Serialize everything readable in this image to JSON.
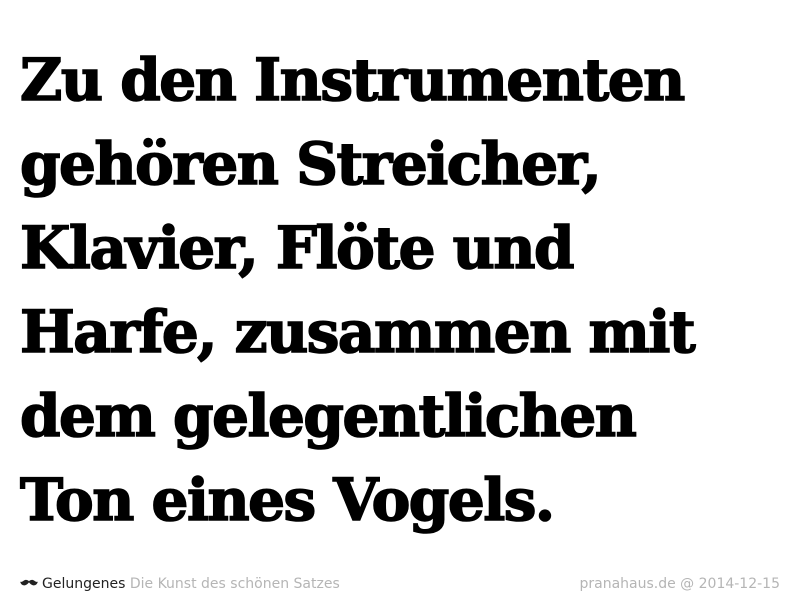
{
  "quote": {
    "lines": [
      "Zu den Instrumenten",
      "gehören Streicher,",
      "Klavier, Flöte und",
      "Harfe, zusammen mit",
      "dem gelegentlichen",
      "Ton eines Vogels."
    ]
  },
  "footer": {
    "icon": "mustache-icon",
    "brand": "Gelungenes",
    "tagline": "Die Kunst des schönen Satzes",
    "credit": "pranahaus.de @ 2014-12-15"
  },
  "colors": {
    "text": "#000000",
    "background": "#ffffff",
    "brand": "#222222",
    "muted": "#b5b5b5"
  }
}
